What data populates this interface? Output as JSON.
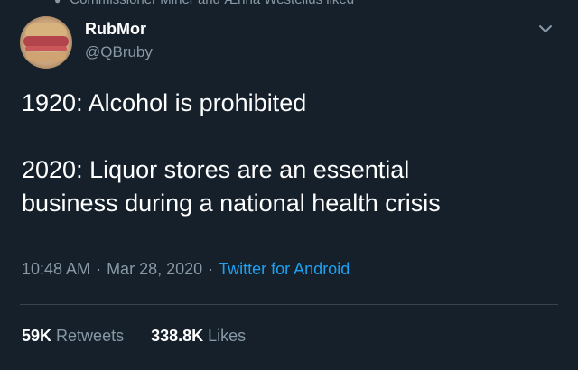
{
  "social_context": {
    "text": "Commissioner Miner and Ænna Westelius liked",
    "icon": "heart-icon"
  },
  "author": {
    "display_name": "RubMor",
    "handle": "@QBruby",
    "avatar_icon": "sandwich-avatar"
  },
  "menu": {
    "icon": "chevron-down-icon"
  },
  "tweet": {
    "line1": "1920: Alcohol is prohibited",
    "line2": "2020: Liquor stores are an essential",
    "line3": "business during a national health crisis"
  },
  "meta": {
    "time": "10:48 AM",
    "sep1": "·",
    "date": "Mar 28, 2020",
    "sep2": "·",
    "source": "Twitter for Android"
  },
  "stats": {
    "retweets_count": "59K",
    "retweets_label": "Retweets",
    "likes_count": "338.8K",
    "likes_label": "Likes"
  },
  "colors": {
    "background": "#15202b",
    "secondary_text": "#8899a6",
    "link": "#1da1f2",
    "divider": "#38444d"
  }
}
